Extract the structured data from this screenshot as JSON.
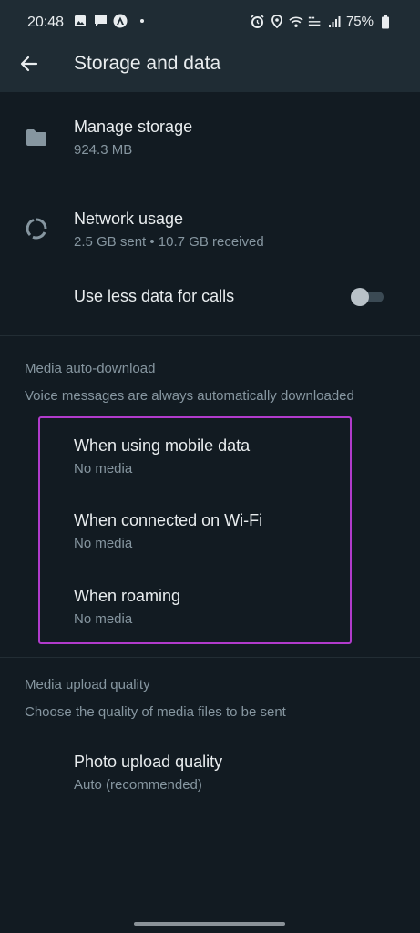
{
  "status_bar": {
    "time": "20:48",
    "battery": "75%",
    "left_icons": [
      "gallery-icon",
      "message-icon",
      "app-notification-icon"
    ],
    "right_icons": [
      "alarm-icon",
      "location-icon",
      "wifi-icon",
      "volte-icon",
      "signal-icon",
      "battery-icon"
    ]
  },
  "app_bar": {
    "title": "Storage and data"
  },
  "items": {
    "manage_storage": {
      "title": "Manage storage",
      "subtitle": "924.3 MB",
      "icon": "folder-icon"
    },
    "network_usage": {
      "title": "Network usage",
      "subtitle": "2.5 GB sent • 10.7 GB received",
      "icon": "data-usage-icon"
    },
    "less_data_calls": {
      "title": "Use less data for calls",
      "enabled": false
    }
  },
  "media_auto_download": {
    "title": "Media auto-download",
    "description": "Voice messages are always automatically downloaded",
    "options": [
      {
        "title": "When using mobile data",
        "value": "No media"
      },
      {
        "title": "When connected on Wi-Fi",
        "value": "No media"
      },
      {
        "title": "When roaming",
        "value": "No media"
      }
    ]
  },
  "media_upload_quality": {
    "title": "Media upload quality",
    "description": "Choose the quality of media files to be sent",
    "photo": {
      "title": "Photo upload quality",
      "value": "Auto (recommended)"
    }
  },
  "colors": {
    "background": "#121b22",
    "header": "#1f2c34",
    "primary_text": "#e9edef",
    "secondary_text": "#8696a0",
    "highlight": "#b13bcc"
  }
}
